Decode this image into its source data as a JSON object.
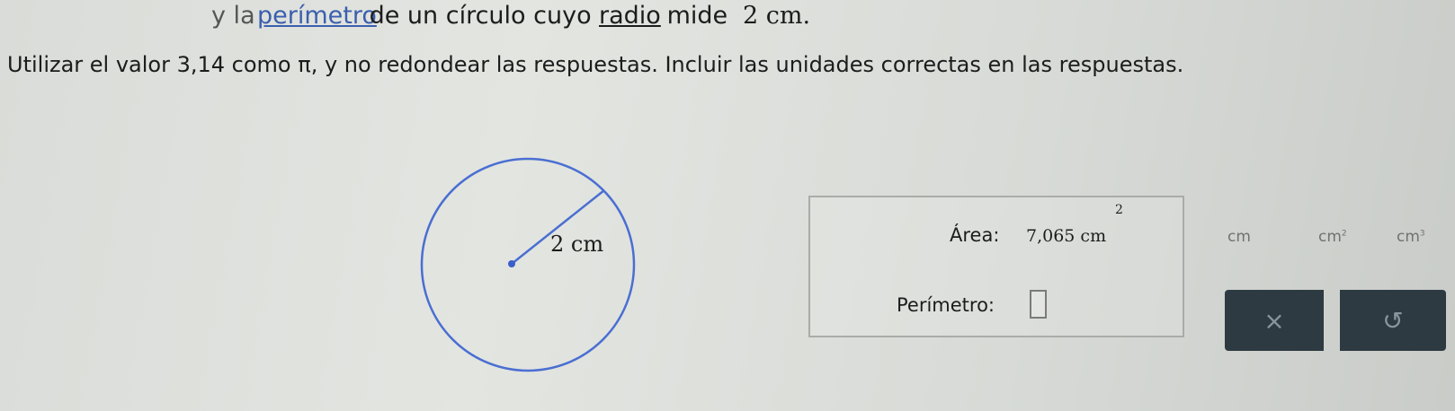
{
  "question": {
    "line1_faded": "y la",
    "line1_link": "perímetro",
    "line1_text_a": " de un círculo cuyo ",
    "line1_radio": "radio",
    "line1_text_b": " mide ",
    "line1_value": "2 cm.",
    "instructions": "Utilizar el valor 3,14 como π, y no redondear las respuestas. Incluir las unidades correctas en las respuestas."
  },
  "figure": {
    "radius_label": "2 cm",
    "circle_color": "#4a6fd2",
    "center_color": "#3b5ec8"
  },
  "answers": {
    "area_label": "Área:",
    "area_value": "7,065 cm",
    "area_exponent": "2",
    "perimeter_label": "Perímetro:",
    "perimeter_value": ""
  },
  "units": {
    "cm": "cm",
    "cm2_base": "cm",
    "cm2_exp": "2",
    "cm3_base": "cm",
    "cm3_exp": "3"
  },
  "tools": {
    "clear_symbol": "×",
    "undo_symbol": "↺"
  }
}
